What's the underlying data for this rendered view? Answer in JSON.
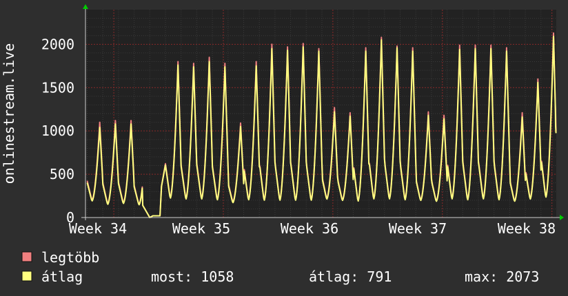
{
  "colors": {
    "background": "#2e2e2e",
    "plot_background": "#222222",
    "grid_minor": "#3a3a3a",
    "grid_major": "#8a2a2a",
    "axis": "#cfcfcf",
    "text": "#ffffff",
    "arrow": "#00cc00",
    "max_series": "#f08080",
    "avg_series": "#ffff80"
  },
  "chart_data": {
    "type": "line",
    "title": "",
    "ylabel": "onlinestream.live",
    "xlabel": "",
    "ylim": [
      0,
      2400
    ],
    "y_ticks": [
      0,
      500,
      1000,
      1500,
      2000
    ],
    "x_ticks": [
      "Week 34",
      "Week 35",
      "Week 36",
      "Week 37",
      "Week 38"
    ],
    "grid": true,
    "legend_position": "bottom-left",
    "day_index": [
      0,
      1,
      2,
      3,
      4,
      5,
      6,
      7,
      8,
      9,
      10,
      11,
      12,
      13,
      14,
      15,
      16,
      17,
      18,
      19,
      20,
      21,
      22,
      23,
      24,
      25,
      26,
      27,
      28,
      29,
      30
    ],
    "series": [
      {
        "name": "legtöbb",
        "color_key": "max_series",
        "daily_peaks": [
          1100,
          1120,
          1120,
          1040,
          0,
          1800,
          1780,
          1850,
          1780,
          1090,
          1800,
          2000,
          1970,
          2010,
          1950,
          1270,
          1210,
          1960,
          2080,
          1980,
          1960,
          1220,
          1180,
          1990,
          1990,
          1990,
          1960,
          1210,
          1600,
          2130,
          1960
        ],
        "daily_troughs": [
          200,
          160,
          170,
          150,
          0,
          230,
          220,
          220,
          210,
          180,
          210,
          200,
          200,
          200,
          200,
          220,
          200,
          190,
          220,
          220,
          210,
          200,
          190,
          220,
          210,
          220,
          210,
          190,
          220,
          240,
          220
        ],
        "last_value": 1210
      },
      {
        "name": "átlag",
        "color_key": "avg_series",
        "daily_peaks": [
          1040,
          1080,
          1080,
          990,
          0,
          1760,
          1740,
          1800,
          1740,
          1050,
          1750,
          1950,
          1930,
          1970,
          1920,
          1220,
          1170,
          1920,
          2050,
          1960,
          1920,
          1180,
          1140,
          1940,
          1950,
          1950,
          1920,
          1160,
          1560,
          2090,
          1920
        ],
        "daily_troughs": [
          190,
          150,
          160,
          145,
          0,
          220,
          210,
          210,
          200,
          170,
          200,
          195,
          195,
          195,
          195,
          210,
          195,
          185,
          210,
          210,
          200,
          195,
          185,
          210,
          200,
          210,
          200,
          185,
          210,
          230,
          210
        ],
        "last_value": 1058
      }
    ],
    "outage": {
      "start_day": 3.55,
      "end_day": 4.75,
      "points": [
        [
          3.55,
          140
        ],
        [
          4.0,
          0
        ],
        [
          4.2,
          20
        ],
        [
          4.65,
          20
        ],
        [
          4.75,
          360
        ]
      ]
    }
  },
  "legend": [
    {
      "label": "legtöbb",
      "color_key": "max_series"
    },
    {
      "label": "átlag",
      "color_key": "avg_series"
    }
  ],
  "stats": {
    "most": "most: 1058",
    "atlag": "átlag: 791",
    "max": "max: 2073"
  }
}
